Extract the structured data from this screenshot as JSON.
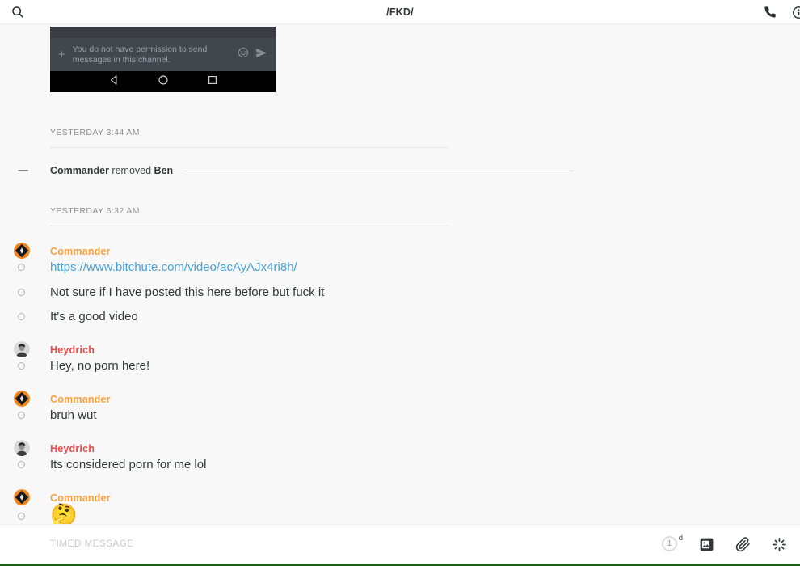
{
  "topbar": {
    "title": "/FKD/"
  },
  "embedded_screenshot": {
    "permission_line1": "You do not have permission to send",
    "permission_line2": "messages in this channel.",
    "plus_glyph": "+"
  },
  "dividers": [
    {
      "label": "YESTERDAY 3:44 AM"
    },
    {
      "label": "YESTERDAY 6:32 AM"
    }
  ],
  "system_message": {
    "actor": "Commander",
    "action": "removed",
    "target": "Ben"
  },
  "conversation": {
    "groups": [
      {
        "author": "Commander",
        "messages": [
          {
            "type": "link",
            "text": "https://www.bitchute.com/video/acAyAJx4ri8h/"
          },
          {
            "type": "text",
            "text": "Not sure if I have posted this here before but fuck it"
          },
          {
            "type": "text",
            "text": "It's a good video"
          }
        ]
      },
      {
        "author": "Heydrich",
        "messages": [
          {
            "type": "text",
            "text": "Hey, no porn here!"
          }
        ]
      },
      {
        "author": "Commander",
        "messages": [
          {
            "type": "text",
            "text": "bruh wut"
          }
        ]
      },
      {
        "author": "Heydrich",
        "messages": [
          {
            "type": "text",
            "text": "Its considered porn for me lol"
          }
        ]
      },
      {
        "author": "Commander",
        "messages": [
          {
            "type": "emoji",
            "text": "🤔"
          }
        ]
      }
    ]
  },
  "composer": {
    "placeholder": "TIMED MESSAGE",
    "timer_value": "1",
    "timer_unit": "d"
  },
  "colors": {
    "commander_name": "#ffa03e",
    "heydrich_name": "#ef4b4b",
    "link": "#4aa0da",
    "commander_avatar_orange": "#ee861f",
    "bottom_green_bar": "#1e5c1e",
    "discord_input_bg": "#42464d",
    "discord_navbar_bg": "#000000"
  }
}
